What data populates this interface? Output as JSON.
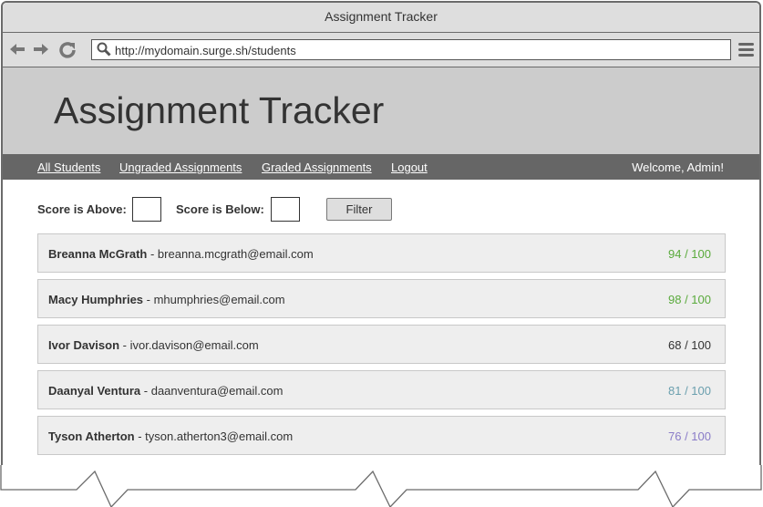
{
  "browser": {
    "window_title": "Assignment Tracker",
    "url": "http://mydomain.surge.sh/students",
    "icons": {
      "back": "arrow-left-icon",
      "forward": "arrow-right-icon",
      "reload": "reload-icon",
      "search": "search-icon",
      "menu": "hamburger-menu-icon"
    }
  },
  "header": {
    "title": "Assignment Tracker"
  },
  "nav": {
    "links": [
      {
        "label": "All Students"
      },
      {
        "label": "Ungraded Assignments"
      },
      {
        "label": "Graded Assignments"
      },
      {
        "label": "Logout"
      }
    ],
    "welcome": "Welcome, Admin!"
  },
  "filter": {
    "above_label": "Score is Above:",
    "above_value": "",
    "below_label": "Score is Below:",
    "below_value": "",
    "button_label": "Filter"
  },
  "students": [
    {
      "name": "Breanna McGrath",
      "email": " - breanna.mcgrath@email.com",
      "score": "94 / 100",
      "score_color": "#5aaa3c"
    },
    {
      "name": "Macy Humphries",
      "email": " - mhumphries@email.com",
      "score": "98 / 100",
      "score_color": "#5aaa3c"
    },
    {
      "name": "Ivor Davison",
      "email": " - ivor.davison@email.com",
      "score": "68 / 100",
      "score_color": "#333333"
    },
    {
      "name": "Daanyal Ventura",
      "email": " - daanventura@email.com",
      "score": "81 / 100",
      "score_color": "#6a9fae"
    },
    {
      "name": "Tyson Atherton",
      "email": " - tyson.atherton3@email.com",
      "score": "76 / 100",
      "score_color": "#8a7cc8"
    }
  ]
}
